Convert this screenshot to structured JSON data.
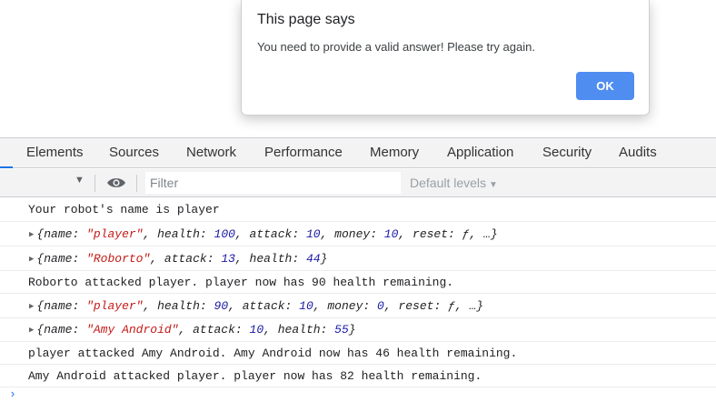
{
  "dialog": {
    "title": "This page says",
    "message": "You need to provide a valid answer! Please try again.",
    "ok_label": "OK"
  },
  "devtools": {
    "tabs": [
      "Elements",
      "Sources",
      "Network",
      "Performance",
      "Memory",
      "Application",
      "Security",
      "Audits"
    ],
    "filter_placeholder": "Filter",
    "levels_label": "Default levels"
  },
  "console": {
    "lines": [
      {
        "type": "text",
        "text": "Your robot's name is player"
      },
      {
        "type": "object",
        "fields": [
          {
            "key": "name",
            "value": "\"player\"",
            "vtype": "string"
          },
          {
            "key": "health",
            "value": "100",
            "vtype": "number"
          },
          {
            "key": "attack",
            "value": "10",
            "vtype": "number"
          },
          {
            "key": "money",
            "value": "10",
            "vtype": "number"
          },
          {
            "key": "reset",
            "value": "ƒ",
            "vtype": "func"
          }
        ],
        "more": "…"
      },
      {
        "type": "object",
        "fields": [
          {
            "key": "name",
            "value": "\"Roborto\"",
            "vtype": "string"
          },
          {
            "key": "attack",
            "value": "13",
            "vtype": "number"
          },
          {
            "key": "health",
            "value": "44",
            "vtype": "number"
          }
        ]
      },
      {
        "type": "text",
        "text": "Roborto attacked player. player now has 90 health remaining."
      },
      {
        "type": "object",
        "fields": [
          {
            "key": "name",
            "value": "\"player\"",
            "vtype": "string"
          },
          {
            "key": "health",
            "value": "90",
            "vtype": "number"
          },
          {
            "key": "attack",
            "value": "10",
            "vtype": "number"
          },
          {
            "key": "money",
            "value": "0",
            "vtype": "number"
          },
          {
            "key": "reset",
            "value": "ƒ",
            "vtype": "func"
          }
        ],
        "more": "…"
      },
      {
        "type": "object",
        "fields": [
          {
            "key": "name",
            "value": "\"Amy Android\"",
            "vtype": "string"
          },
          {
            "key": "attack",
            "value": "10",
            "vtype": "number"
          },
          {
            "key": "health",
            "value": "55",
            "vtype": "number"
          }
        ]
      },
      {
        "type": "text",
        "text": "player attacked Amy Android. Amy Android now has 46 health remaining."
      },
      {
        "type": "text",
        "text": "Amy Android attacked player. player now has 82 health remaining."
      }
    ],
    "prompt_glyph": "›"
  }
}
